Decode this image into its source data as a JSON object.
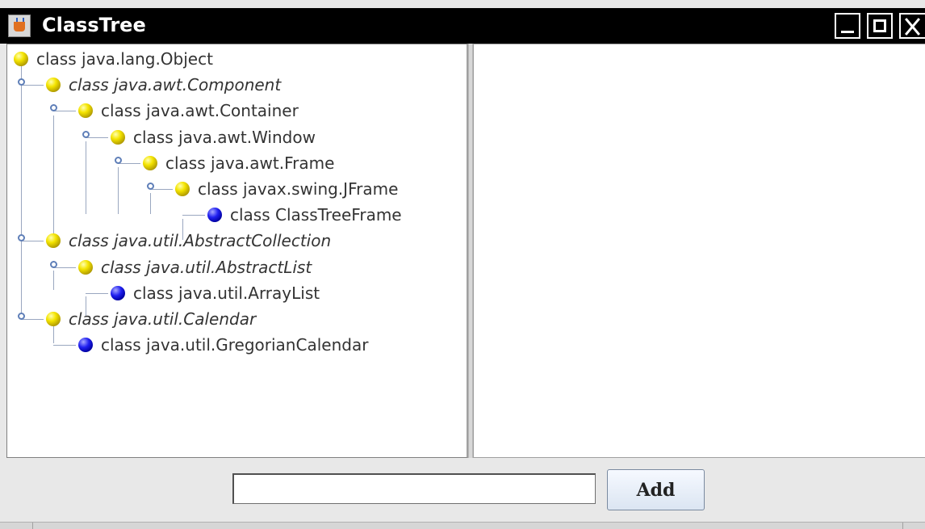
{
  "window": {
    "title": "ClassTree",
    "icon": "java-cup-icon",
    "controls": [
      "minimize-icon",
      "maximize-icon",
      "close-icon"
    ]
  },
  "tree": {
    "nodes": [
      {
        "label": "class java.lang.Object",
        "depth": 0,
        "icon": "yellow-ball",
        "italic": false,
        "expanded": true
      },
      {
        "label": "class java.awt.Component",
        "depth": 1,
        "icon": "yellow-ball",
        "italic": true,
        "expanded": true
      },
      {
        "label": "class java.awt.Container",
        "depth": 2,
        "icon": "yellow-ball",
        "italic": false,
        "expanded": true
      },
      {
        "label": "class java.awt.Window",
        "depth": 3,
        "icon": "yellow-ball",
        "italic": false,
        "expanded": true
      },
      {
        "label": "class java.awt.Frame",
        "depth": 4,
        "icon": "yellow-ball",
        "italic": false,
        "expanded": true
      },
      {
        "label": "class javax.swing.JFrame",
        "depth": 5,
        "icon": "yellow-ball",
        "italic": false,
        "expanded": true
      },
      {
        "label": "class ClassTreeFrame",
        "depth": 6,
        "icon": "blue-ball",
        "italic": false,
        "leaf": true
      },
      {
        "label": "class java.util.AbstractCollection",
        "depth": 1,
        "icon": "yellow-ball",
        "italic": true,
        "expanded": true
      },
      {
        "label": "class java.util.AbstractList",
        "depth": 2,
        "icon": "yellow-ball",
        "italic": true,
        "expanded": true
      },
      {
        "label": "class java.util.ArrayList",
        "depth": 3,
        "icon": "blue-ball",
        "italic": false,
        "leaf": true
      },
      {
        "label": "class java.util.Calendar",
        "depth": 1,
        "icon": "yellow-ball",
        "italic": true,
        "expanded": true
      },
      {
        "label": "class java.util.GregorianCalendar",
        "depth": 2,
        "icon": "blue-ball",
        "italic": false,
        "leaf": true
      }
    ]
  },
  "details_pane": {
    "text": ""
  },
  "input": {
    "value": "",
    "placeholder": ""
  },
  "add_button": {
    "label": "Add"
  },
  "colors": {
    "titlebar": "#000000",
    "tree_line": "#9aa7c0",
    "abstract_ball": "#f4e400",
    "concrete_ball": "#2020f0"
  }
}
